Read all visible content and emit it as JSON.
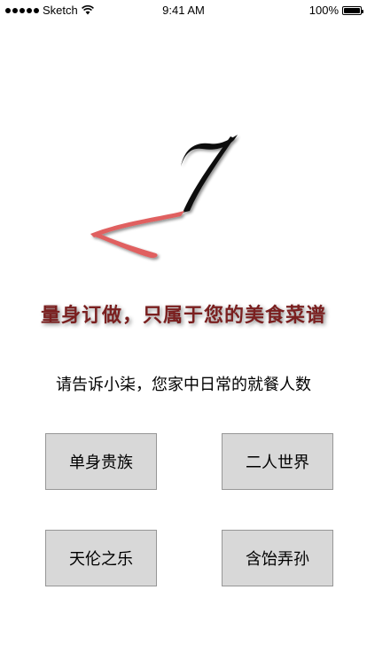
{
  "status_bar": {
    "carrier": "Sketch",
    "time": "9:41 AM",
    "battery": "100%",
    "signal_icon": "signal-dots-icon",
    "wifi_icon": "wifi-icon",
    "battery_icon": "battery-icon"
  },
  "header": {
    "logo_icon": "number-seven-logo-icon",
    "slogan": "量身订做，只属于您的美食菜谱"
  },
  "main": {
    "prompt": "请告诉小柒，您家中日常的就餐人数",
    "options": [
      {
        "label": "单身贵族"
      },
      {
        "label": "二人世界"
      },
      {
        "label": "天伦之乐"
      },
      {
        "label": "含饴弄孙"
      }
    ]
  },
  "colors": {
    "slogan": "#7a1f1f",
    "logo_dark": "#111111",
    "logo_red": "#e06060",
    "button_bg": "#d8d8d8",
    "button_border": "#979797"
  }
}
